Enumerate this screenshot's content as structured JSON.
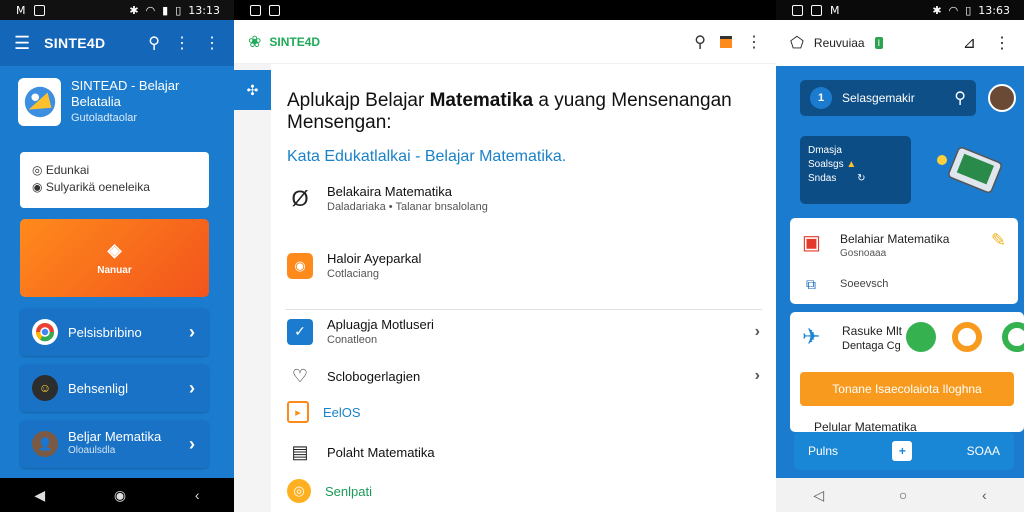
{
  "panel1": {
    "status_time": "13:13",
    "app_title": "SINTE4D",
    "hero_title": "SINTEAD - Belajar Belatalia",
    "hero_sub": "Gutoladtaolar",
    "card_line1": "Edunkai",
    "card_line2": "Sulyarikä oeneleika",
    "banner_label": "Nanuar",
    "items": [
      {
        "label": "Pelsisbribino"
      },
      {
        "label": "Behsenligl"
      },
      {
        "label": "Beljar Mematika",
        "sub": "Oloaulsdla"
      }
    ]
  },
  "panel2": {
    "app_title": "SINTE4D",
    "headline_a": "Aplukajp Belajar ",
    "headline_b": "Matematika",
    "headline_c": "a yuang Mensenangan Mensengan:",
    "subhead": "Kata Edukatlalkai - Belajar Matematika.",
    "rows": [
      {
        "title": "Belakaira Matematika",
        "sub": "Daladariaka • Talanar bnsalolang"
      },
      {
        "title": "Haloir Ayeparkal",
        "sub": "Cotlaciang"
      },
      {
        "title": "Apluagja Motluseri",
        "sub": "Conatleon"
      },
      {
        "title": "Sclobogerlagien",
        "sub": ""
      },
      {
        "title": "EelOS",
        "sub": ""
      },
      {
        "title": "Polaht Matematika",
        "sub": ""
      },
      {
        "title": "Senlpati",
        "sub": ""
      }
    ]
  },
  "panel3": {
    "status_time": "13:63",
    "app_title": "Reuvuiaa",
    "badge": "I",
    "search_text": "Selasgemakir",
    "search_badge": "1",
    "promo_line1": "Dmasja",
    "promo_line2": "Soalsgs",
    "promo_line3": "Sndas",
    "card1_title": "Belahiar Matematika",
    "card1_sub": "Gosnoaaa",
    "card1_link": "Soeevsch",
    "card2_title": "Rasuke Mlt",
    "card2_sub": "Dentaga Cg",
    "orange_btn": "Tonane Isaecolaiota Iloghna",
    "card3_title": "Pelular Matematika",
    "fab_left": "Pulns",
    "fab_right": "SOAA"
  }
}
